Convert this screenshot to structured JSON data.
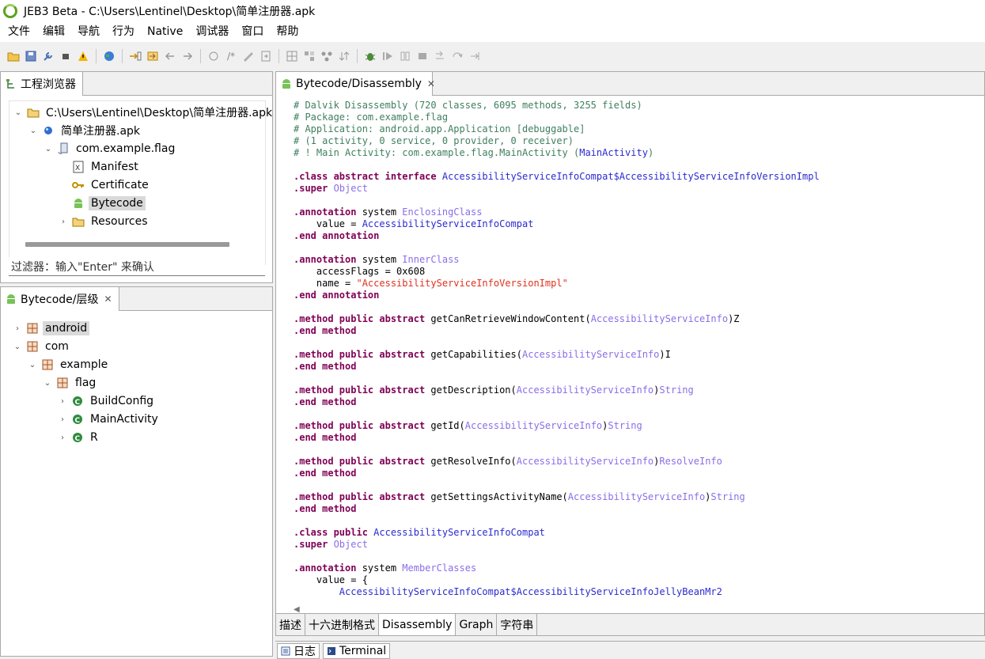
{
  "window": {
    "title": "JEB3 Beta - C:\\Users\\Lentinel\\Desktop\\简单注册器.apk"
  },
  "menu": [
    "文件",
    "编辑",
    "导航",
    "行为",
    "Native",
    "调试器",
    "窗口",
    "帮助"
  ],
  "project_panel": {
    "tab_label": "工程浏览器",
    "tree": {
      "root": "C:\\Users\\Lentinel\\Desktop\\简单注册器.apk",
      "apk": "简单注册器.apk",
      "package": "com.example.flag",
      "manifest": "Manifest",
      "certificate": "Certificate",
      "bytecode": "Bytecode",
      "resources": "Resources"
    },
    "filter_placeholder": "过滤器：输入\"Enter\" 来确认"
  },
  "hierarchy_panel": {
    "tab_label": "Bytecode/层级",
    "tree": {
      "android": "android",
      "com": "com",
      "example": "example",
      "flag": "flag",
      "buildconfig": "BuildConfig",
      "mainactivity": "MainActivity",
      "r": "R"
    }
  },
  "editor": {
    "tab_label": "Bytecode/Disassembly",
    "bottom_tabs": [
      "描述",
      "十六进制格式",
      "Disassembly",
      "Graph",
      "字符串"
    ],
    "active_bottom_tab": "Disassembly",
    "lines": [
      [
        [
          "c-comment",
          "# Dalvik Disassembly (720 classes, 6095 methods, 3255 fields)"
        ]
      ],
      [
        [
          "c-comment",
          "# Package: com.example.flag"
        ]
      ],
      [
        [
          "c-comment",
          "# Application: android.app.Application [debuggable]"
        ]
      ],
      [
        [
          "c-comment",
          "# (1 activity, 0 service, 0 provider, 0 receiver)"
        ]
      ],
      [
        [
          "c-comment",
          "# ! Main Activity: com.example.flag.MainActivity ("
        ],
        [
          "c-type",
          "MainActivity"
        ],
        [
          "c-comment",
          ")"
        ]
      ],
      [],
      [
        [
          "c-kw",
          ".class abstract interface "
        ],
        [
          "c-type",
          "AccessibilityServiceInfoCompat$AccessibilityServiceInfoVersionImpl"
        ]
      ],
      [
        [
          "c-kw",
          ".super "
        ],
        [
          "c-ref",
          "Object"
        ]
      ],
      [],
      [
        [
          "c-kw",
          ".annotation "
        ],
        [
          "c-plain",
          "system "
        ],
        [
          "c-ref",
          "EnclosingClass"
        ]
      ],
      [
        [
          "c-plain",
          "    value = "
        ],
        [
          "c-type",
          "AccessibilityServiceInfoCompat"
        ]
      ],
      [
        [
          "c-kw",
          ".end annotation"
        ]
      ],
      [],
      [
        [
          "c-kw",
          ".annotation "
        ],
        [
          "c-plain",
          "system "
        ],
        [
          "c-ref",
          "InnerClass"
        ]
      ],
      [
        [
          "c-plain",
          "    accessFlags = 0x608"
        ]
      ],
      [
        [
          "c-plain",
          "    name = "
        ],
        [
          "c-str",
          "\"AccessibilityServiceInfoVersionImpl\""
        ]
      ],
      [
        [
          "c-kw",
          ".end annotation"
        ]
      ],
      [],
      [
        [
          "c-kw",
          ".method public abstract "
        ],
        [
          "c-plain",
          "getCanRetrieveWindowContent("
        ],
        [
          "c-ref",
          "AccessibilityServiceInfo"
        ],
        [
          "c-plain",
          ")Z"
        ]
      ],
      [
        [
          "c-kw",
          ".end method"
        ]
      ],
      [],
      [
        [
          "c-kw",
          ".method public abstract "
        ],
        [
          "c-plain",
          "getCapabilities("
        ],
        [
          "c-ref",
          "AccessibilityServiceInfo"
        ],
        [
          "c-plain",
          ")I"
        ]
      ],
      [
        [
          "c-kw",
          ".end method"
        ]
      ],
      [],
      [
        [
          "c-kw",
          ".method public abstract "
        ],
        [
          "c-plain",
          "getDescription("
        ],
        [
          "c-ref",
          "AccessibilityServiceInfo"
        ],
        [
          "c-plain",
          ")"
        ],
        [
          "c-ref",
          "String"
        ]
      ],
      [
        [
          "c-kw",
          ".end method"
        ]
      ],
      [],
      [
        [
          "c-kw",
          ".method public abstract "
        ],
        [
          "c-plain",
          "getId("
        ],
        [
          "c-ref",
          "AccessibilityServiceInfo"
        ],
        [
          "c-plain",
          ")"
        ],
        [
          "c-ref",
          "String"
        ]
      ],
      [
        [
          "c-kw",
          ".end method"
        ]
      ],
      [],
      [
        [
          "c-kw",
          ".method public abstract "
        ],
        [
          "c-plain",
          "getResolveInfo("
        ],
        [
          "c-ref",
          "AccessibilityServiceInfo"
        ],
        [
          "c-plain",
          ")"
        ],
        [
          "c-ref",
          "ResolveInfo"
        ]
      ],
      [
        [
          "c-kw",
          ".end method"
        ]
      ],
      [],
      [
        [
          "c-kw",
          ".method public abstract "
        ],
        [
          "c-plain",
          "getSettingsActivityName("
        ],
        [
          "c-ref",
          "AccessibilityServiceInfo"
        ],
        [
          "c-plain",
          ")"
        ],
        [
          "c-ref",
          "String"
        ]
      ],
      [
        [
          "c-kw",
          ".end method"
        ]
      ],
      [],
      [
        [
          "c-kw",
          ".class public "
        ],
        [
          "c-type",
          "AccessibilityServiceInfoCompat"
        ]
      ],
      [
        [
          "c-kw",
          ".super "
        ],
        [
          "c-ref",
          "Object"
        ]
      ],
      [],
      [
        [
          "c-kw",
          ".annotation "
        ],
        [
          "c-plain",
          "system "
        ],
        [
          "c-ref",
          "MemberClasses"
        ]
      ],
      [
        [
          "c-plain",
          "    value = {"
        ]
      ],
      [
        [
          "c-type",
          "        AccessibilityServiceInfoCompat$AccessibilityServiceInfoJellyBeanMr2"
        ]
      ]
    ]
  },
  "console_tabs": [
    "日志",
    "Terminal"
  ],
  "colors": {
    "android_green": "#78c257",
    "package_brown": "#a0522d",
    "class_green": "#2e8b3e"
  }
}
